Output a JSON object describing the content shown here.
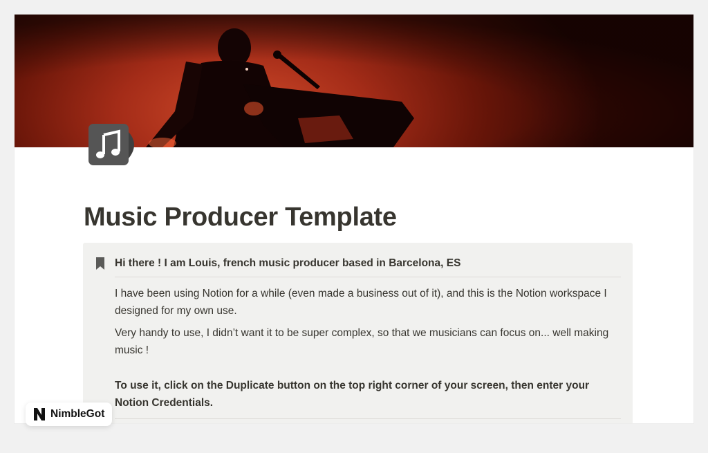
{
  "page": {
    "title": "Music Producer Template",
    "cover_icon": "music-note-icon",
    "accent_color": "#b8341c"
  },
  "callout": {
    "icon": "bookmark-icon",
    "heading": "Hi there ! I am Louis, french music producer based in Barcelona, ES",
    "paragraphs": [
      "I have been using Notion for a while (even made a business out of it), and this is the Notion workspace I designed for my own use.",
      "Very handy to use, I didn’t want it to be super complex, so that we musicians can focus on... well making music !"
    ],
    "instruction": "To use it, click on the Duplicate button on the top right corner of your screen, then enter your Notion Credentials."
  },
  "watermark": {
    "logo": "N",
    "label": "NimbleGot"
  }
}
